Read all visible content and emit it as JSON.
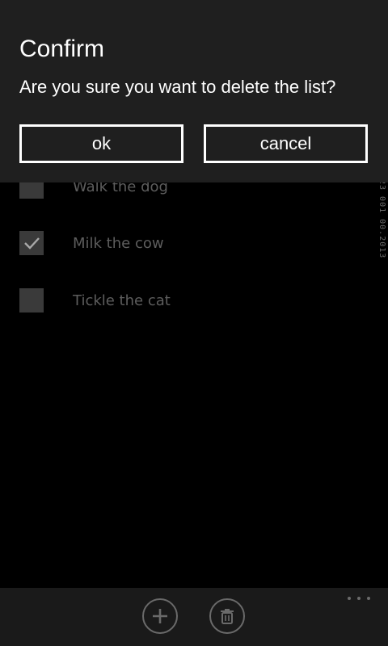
{
  "dialog": {
    "title": "Confirm",
    "message": "Are you sure you want to delete the list?",
    "ok_label": "ok",
    "cancel_label": "cancel"
  },
  "list": {
    "items": [
      {
        "label": "Walk the dog",
        "checked": false
      },
      {
        "label": "Milk the cow",
        "checked": true
      },
      {
        "label": "Tickle the cat",
        "checked": false
      }
    ]
  },
  "side_text": "23 001 00.2013",
  "appbar": {
    "add_icon": "plus-icon",
    "delete_icon": "trash-icon",
    "more_icon": "ellipsis-icon"
  },
  "colors": {
    "background": "#000000",
    "dialog_background": "#1f1f1f",
    "appbar_background": "#1a1a1a",
    "foreground": "#ffffff",
    "dimmed_text": "#5d5d5d"
  }
}
